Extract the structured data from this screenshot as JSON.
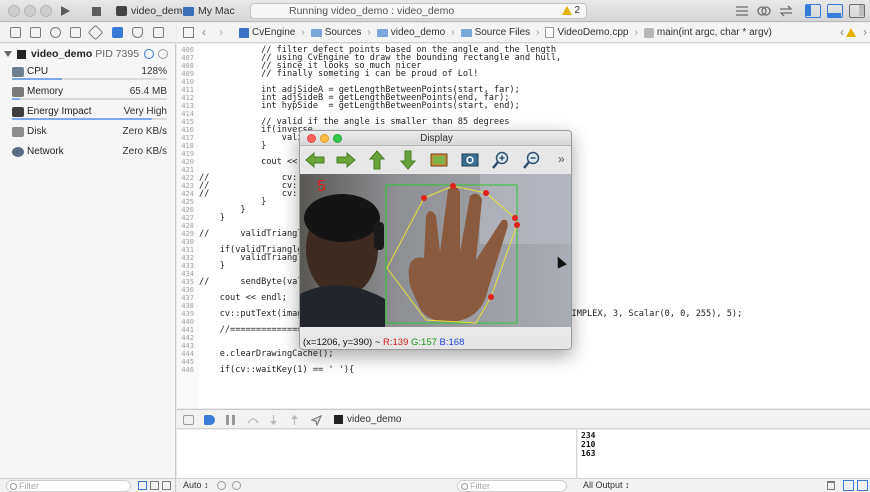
{
  "titlebar": {
    "scheme_name": "video_demo",
    "destination": "My Mac",
    "status_text": "Running video_demo : video_demo",
    "warning_count": "2"
  },
  "jumpbar": {
    "crumbs": [
      "CvEngine",
      "Sources",
      "video_demo",
      "Source Files",
      "VideoDemo.cpp",
      "main(int argc, char * argv)"
    ]
  },
  "navigator": {
    "process_name": "video_demo",
    "process_pid": "PID 7395",
    "gauges": [
      {
        "label": "CPU",
        "value": "128%",
        "fill": 0.32
      },
      {
        "label": "Memory",
        "value": "65.4 MB",
        "fill": 0.05
      },
      {
        "label": "Energy Impact",
        "value": "Very High",
        "fill": 0.9
      },
      {
        "label": "Disk",
        "value": "Zero KB/s",
        "fill": 0
      },
      {
        "label": "Network",
        "value": "Zero KB/s",
        "fill": 0
      }
    ],
    "filter_placeholder": "Filter"
  },
  "code": [
    {
      "n": "406",
      "t": "            // filter defect points based on the angle and the length",
      "c": "cm"
    },
    {
      "n": "407",
      "t": "            // using CvEngine to draw the bounding rectangle and hull,",
      "c": "cm"
    },
    {
      "n": "408",
      "t": "            // since it looks so much nicer",
      "c": "cm"
    },
    {
      "n": "409",
      "t": "            // finally someting i can be proud of Lol!",
      "c": "cm"
    },
    {
      "n": "410",
      "t": "",
      "c": ""
    },
    {
      "n": "411",
      "t": "            int adjSideA = getLengthBetweenPoints(start, far);",
      "c": ""
    },
    {
      "n": "412",
      "t": "            int adjSideB = getLengthBetweenPoints(end, far);",
      "c": ""
    },
    {
      "n": "413",
      "t": "            int hypSide  = getLengthBetweenPoints(start, end);",
      "c": ""
    },
    {
      "n": "414",
      "t": "",
      "c": ""
    },
    {
      "n": "415",
      "t": "            // valid if the angle is smaller than 85 degrees",
      "c": "cm"
    },
    {
      "n": "416",
      "t": "            if(inverse",
      "c": ""
    },
    {
      "n": "417",
      "t": "                validTri",
      "c": ""
    },
    {
      "n": "418",
      "t": "            }",
      "c": ""
    },
    {
      "n": "419",
      "t": "",
      "c": ""
    },
    {
      "n": "420",
      "t": "            cout << ad",
      "c": ""
    },
    {
      "n": "421",
      "t": "",
      "c": ""
    },
    {
      "n": "422",
      "t": "//              cv::line",
      "c": "cm"
    },
    {
      "n": "423",
      "t": "//              cv::line",
      "c": "cm"
    },
    {
      "n": "424",
      "t": "//              cv::line",
      "c": "cm"
    },
    {
      "n": "425",
      "t": "            }",
      "c": ""
    },
    {
      "n": "426",
      "t": "        }",
      "c": ""
    },
    {
      "n": "427",
      "t": "    }",
      "c": ""
    },
    {
      "n": "428",
      "t": "",
      "c": ""
    },
    {
      "n": "429",
      "t": "//      validTriangleC",
      "c": "cm"
    },
    {
      "n": "430",
      "t": "",
      "c": ""
    },
    {
      "n": "431",
      "t": "    if(validTriangle",
      "c": ""
    },
    {
      "n": "432",
      "t": "        validTriangleC",
      "c": ""
    },
    {
      "n": "433",
      "t": "    }",
      "c": ""
    },
    {
      "n": "434",
      "t": "",
      "c": ""
    },
    {
      "n": "435",
      "t": "//      sendByte(valid",
      "c": "cm"
    },
    {
      "n": "436",
      "t": "",
      "c": ""
    },
    {
      "n": "437",
      "t": "    cout << endl;",
      "c": ""
    },
    {
      "n": "438",
      "t": "",
      "c": ""
    },
    {
      "n": "439",
      "t": "    cv::putText(imag                                        NT_HERSHEY_SIMPLEX, 3, Scalar(0, 0, 255), 5);",
      "c": ""
    },
    {
      "n": "440",
      "t": "",
      "c": ""
    },
    {
      "n": "441",
      "t": "    //========================================",
      "c": "cm"
    },
    {
      "n": "442",
      "t": "",
      "c": ""
    },
    {
      "n": "443",
      "t": "",
      "c": ""
    },
    {
      "n": "444",
      "t": "    e.clearDrawingCache();",
      "c": ""
    },
    {
      "n": "445",
      "t": "",
      "c": ""
    },
    {
      "n": "446",
      "t": "    if(cv::waitKey(1) == ' '){",
      "c": ""
    }
  ],
  "debug": {
    "process_label": "video_demo",
    "console_lines": [
      "234",
      "210",
      "163"
    ],
    "auto_label": "Auto ↕",
    "filter_placeholder": "Filter",
    "output_label": "All Output ↕"
  },
  "display_window": {
    "title": "Display",
    "overlay_number": "5",
    "status_coords": "(x=1206, y=390) ~",
    "status_r": "R:139",
    "status_g": "G:157",
    "status_b": "B:168"
  },
  "colors": {
    "accent": "#3a7ad9",
    "comment": "#1b7a15",
    "keyword": "#a51fa0",
    "hull": "#e8e03a",
    "bounding_box": "#2fc52f",
    "defect_points": "#e0201c"
  }
}
